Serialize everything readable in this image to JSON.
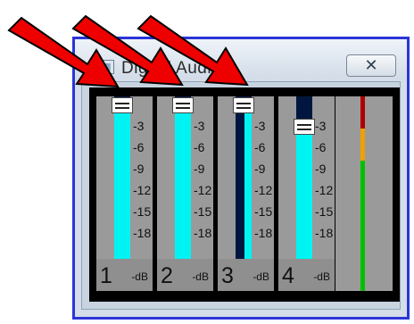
{
  "window": {
    "title": "Digital Audio",
    "close_label": "✕"
  },
  "mixer": {
    "scale_labels": [
      "3",
      "6",
      "9",
      "12",
      "15",
      "18"
    ],
    "channels": [
      {
        "number": "1",
        "unit": "-dB",
        "level": 0.95
      },
      {
        "number": "2",
        "unit": "-dB",
        "level": 0.95
      },
      {
        "number": "3",
        "unit": "-dB",
        "level": 0.95
      },
      {
        "number": "4",
        "unit": "-dB",
        "level": 0.82
      }
    ]
  },
  "master_meter": {
    "colors": [
      "#b00000",
      "#f0a000",
      "#00c000"
    ]
  },
  "annotations": {
    "arrow_color": "#ee0000",
    "arrow_count": 3
  }
}
